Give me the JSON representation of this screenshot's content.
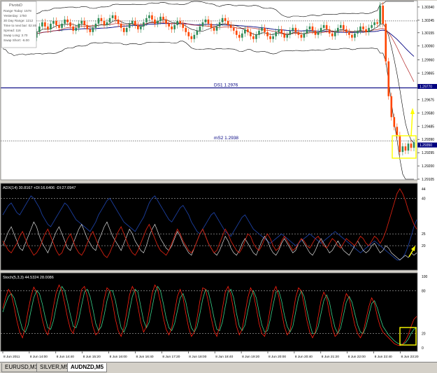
{
  "colors": {
    "main_bg": "#ffffff",
    "indicator_bg": "#000000",
    "bull": "#2e8b57",
    "bear": "#ff4500",
    "band": "#000000",
    "ma_red": "#b22222",
    "ma_navy": "#000080",
    "pivot_line": "#000080",
    "adx_blue": "#1c3f9f",
    "adx_red": "#d02010",
    "adx_white": "#d8d8d8",
    "stoch_red": "#ff2010",
    "stoch_green": "#3ad08a",
    "highlight": "#ffff00"
  },
  "pivot_box": {
    "title": "PivotsD",
    "rows": [
      "Range  Today:   1578",
      "Yesterday:   1750",
      "30 Day Range:   1212",
      "Time to next bar:   02:46",
      "Spread:   116",
      "Swap  Long:   3.70",
      "Swap  Short:   -6.00"
    ]
  },
  "chart_data": [
    {
      "type": "candlestick",
      "name": "AUDNZD,M5",
      "y_axis_labels": [
        "1.30340",
        "1.30245",
        "1.30155",
        "1.30060",
        "1.29960",
        "1.29865",
        "1.29770",
        "1.29675",
        "1.29580",
        "1.29485",
        "1.29390",
        "1.29350",
        "1.29295",
        "1.29200",
        "1.29105"
      ],
      "ylim": [
        1.29105,
        1.3038
      ],
      "levels": [
        {
          "label": "",
          "value": 1.3024,
          "style": "dotted"
        },
        {
          "label": "DS1   1.2976",
          "value": 1.2976,
          "style": "solid"
        },
        {
          "label": "mS2   1.2938",
          "value": 1.2938,
          "style": "dotted"
        }
      ],
      "price_markers": [
        {
          "value": 1.2977,
          "text": "1.29770"
        },
        {
          "value": 1.2935,
          "text": "1.29350"
        }
      ],
      "x_axis_labels": [
        "8 Jun 2011",
        "8 Jun 14:00",
        "8 Jun 14:40",
        "8 Jun 15:20",
        "8 Jun 16:00",
        "8 Jun 16:40",
        "8 Jun 17:20",
        "8 Jun 18:00",
        "8 Jun 18:40",
        "8 Jun 19:20",
        "8 Jun 20:00",
        "8 Jun 20:40",
        "8 Jun 21:20",
        "8 Jun 22:00",
        "8 Jun 22:40",
        "8 Jun 23:20"
      ],
      "series": [
        {
          "name": "price",
          "values": [
            1.3011,
            1.3012,
            1.3009,
            1.3014,
            1.3018,
            1.3016,
            1.3013,
            1.3017,
            1.3021,
            1.3019,
            1.3015,
            1.3012,
            1.3016,
            1.302,
            1.3023,
            1.302,
            1.3018,
            1.3022,
            1.3024,
            1.3021,
            1.3019,
            1.3022,
            1.3025,
            1.3023,
            1.302,
            1.3017,
            1.3019,
            1.3022,
            1.3024,
            1.3021,
            1.3018,
            1.3016,
            1.3019,
            1.3022,
            1.3026,
            1.3024,
            1.3021,
            1.3023,
            1.3026,
            1.3028,
            1.3025,
            1.3022,
            1.3019,
            1.3016,
            1.3019,
            1.3022,
            1.3024,
            1.3021,
            1.3018,
            1.302,
            1.3023,
            1.3026,
            1.3028,
            1.3025,
            1.3022,
            1.3024,
            1.3027,
            1.3025,
            1.3022,
            1.302,
            1.3018,
            1.3021,
            1.3024,
            1.3022,
            1.3019,
            1.3016,
            1.3013,
            1.3011,
            1.3014,
            1.3017,
            1.302,
            1.3023,
            1.3025,
            1.3022,
            1.3019,
            1.3017,
            1.302,
            1.3023,
            1.3026,
            1.3024,
            1.3021,
            1.3019,
            1.3017,
            1.3014,
            1.3012,
            1.3015,
            1.3018,
            1.3016,
            1.3013,
            1.3011,
            1.3014,
            1.3017,
            1.3019,
            1.3016,
            1.3013,
            1.3011,
            1.3013,
            1.3016,
            1.3018,
            1.3015,
            1.3012,
            1.3014,
            1.3017,
            1.3019,
            1.3016,
            1.3014,
            1.3012,
            1.3015,
            1.3018,
            1.302,
            1.3017,
            1.3014,
            1.3016,
            1.3019,
            1.3021,
            1.3018,
            1.3015,
            1.3013,
            1.3016,
            1.3019,
            1.3021,
            1.3018,
            1.3016,
            1.3014,
            1.3012,
            1.3015,
            1.3017,
            1.302,
            1.3018,
            1.3016,
            1.3019,
            1.3021,
            1.3023,
            1.3022,
            1.3035,
            1.3022,
            1.2995,
            1.297,
            1.2955,
            1.2948,
            1.2942,
            1.293,
            1.2934,
            1.2931,
            1.2936,
            1.2933,
            1.2937
          ]
        }
      ]
    },
    {
      "type": "line",
      "name": "ADX(14) 30.8167 +DI:16.6406 -DI:27.0947",
      "y_axis_labels": [
        "44",
        "40",
        "25",
        "20"
      ],
      "ylim": [
        10,
        46
      ],
      "levels": [
        40,
        25,
        20
      ],
      "series": [
        {
          "name": "ADX",
          "values": [
            33,
            35,
            37,
            38,
            36,
            34,
            33,
            35,
            37,
            39,
            41,
            40,
            38,
            36,
            33,
            31,
            29,
            28,
            30,
            32,
            34,
            36,
            38,
            37,
            35,
            33,
            31,
            30,
            29,
            28,
            27,
            26,
            28,
            30,
            33,
            35,
            37,
            39,
            40,
            38,
            36,
            34,
            32,
            30,
            29,
            28,
            27,
            26,
            28,
            30,
            32,
            35,
            38,
            40,
            41,
            39,
            37,
            35,
            33,
            31,
            30,
            32,
            34,
            36,
            37,
            35,
            33,
            30,
            28,
            26,
            25,
            27,
            29,
            31,
            33,
            34,
            32,
            30,
            28,
            26,
            25,
            24,
            26,
            28,
            30,
            32,
            33,
            31,
            29,
            27,
            26,
            25,
            24,
            23,
            22,
            21,
            22,
            23,
            24,
            25,
            24,
            23,
            22,
            21,
            20,
            21,
            22,
            23,
            24,
            25,
            24,
            23,
            22,
            21,
            22,
            23,
            24,
            25,
            26,
            25,
            24,
            23,
            22,
            21,
            20,
            19,
            18,
            17,
            18,
            19,
            20,
            21,
            22,
            21,
            20,
            19,
            18,
            17,
            16,
            15,
            14,
            14,
            15,
            17,
            20,
            24,
            28,
            31
          ]
        },
        {
          "name": "+DI",
          "values": [
            20,
            23,
            26,
            28,
            25,
            22,
            19,
            18,
            21,
            24,
            27,
            30,
            28,
            24,
            21,
            19,
            17,
            20,
            23,
            26,
            28,
            25,
            22,
            19,
            18,
            21,
            24,
            27,
            29,
            26,
            23,
            21,
            19,
            18,
            22,
            25,
            28,
            30,
            27,
            24,
            22,
            20,
            18,
            21,
            24,
            27,
            25,
            22,
            20,
            18,
            17,
            20,
            24,
            27,
            29,
            26,
            23,
            21,
            19,
            18,
            20,
            23,
            26,
            24,
            21,
            19,
            17,
            16,
            19,
            22,
            25,
            27,
            24,
            21,
            19,
            17,
            16,
            18,
            21,
            24,
            22,
            19,
            17,
            16,
            18,
            21,
            23,
            21,
            19,
            17,
            16,
            19,
            22,
            24,
            22,
            19,
            17,
            16,
            18,
            21,
            23,
            21,
            19,
            17,
            18,
            21,
            23,
            21,
            19,
            17,
            16,
            18,
            21,
            23,
            21,
            19,
            17,
            18,
            20,
            22,
            20,
            18,
            17,
            16,
            18,
            20,
            22,
            20,
            18,
            17,
            18,
            20,
            21,
            19,
            17,
            18,
            20,
            19,
            17,
            16,
            15,
            14,
            15,
            16,
            15,
            17,
            16,
            17
          ]
        },
        {
          "name": "-DI",
          "values": [
            22,
            20,
            18,
            17,
            19,
            21,
            24,
            26,
            23,
            20,
            18,
            16,
            17,
            19,
            22,
            25,
            27,
            24,
            21,
            18,
            16,
            17,
            20,
            23,
            25,
            22,
            19,
            17,
            16,
            18,
            21,
            24,
            26,
            23,
            20,
            18,
            16,
            15,
            17,
            20,
            23,
            26,
            28,
            25,
            22,
            19,
            17,
            16,
            18,
            21,
            24,
            27,
            29,
            26,
            23,
            20,
            18,
            17,
            16,
            18,
            21,
            24,
            27,
            25,
            22,
            20,
            18,
            17,
            19,
            22,
            25,
            27,
            24,
            21,
            19,
            17,
            18,
            21,
            24,
            27,
            25,
            22,
            20,
            18,
            17,
            19,
            22,
            25,
            24,
            21,
            19,
            18,
            20,
            23,
            25,
            23,
            20,
            18,
            19,
            22,
            24,
            22,
            20,
            18,
            19,
            21,
            23,
            22,
            20,
            19,
            21,
            23,
            24,
            22,
            20,
            19,
            21,
            23,
            22,
            20,
            19,
            21,
            23,
            22,
            21,
            20,
            22,
            24,
            23,
            21,
            20,
            22,
            24,
            23,
            21,
            23,
            26,
            30,
            34,
            38,
            42,
            44,
            42,
            39,
            35,
            32,
            29,
            27
          ]
        }
      ]
    },
    {
      "type": "line",
      "name": "Stoch(5,3,3) 44.5324 28.0086",
      "y_axis_labels": [
        "100",
        "80",
        "20",
        "0"
      ],
      "ylim": [
        0,
        100
      ],
      "levels": [
        80,
        20
      ],
      "series": [
        {
          "name": "%K",
          "values": [
            55,
            70,
            82,
            75,
            58,
            38,
            22,
            14,
            30,
            52,
            72,
            85,
            78,
            60,
            40,
            25,
            18,
            35,
            58,
            78,
            88,
            80,
            62,
            42,
            26,
            20,
            38,
            62,
            82,
            86,
            72,
            50,
            30,
            18,
            22,
            45,
            68,
            84,
            80,
            62,
            40,
            24,
            16,
            28,
            50,
            74,
            86,
            78,
            58,
            36,
            22,
            30,
            52,
            76,
            88,
            82,
            64,
            42,
            26,
            18,
            28,
            50,
            72,
            82,
            70,
            48,
            28,
            16,
            22,
            42,
            66,
            84,
            82,
            64,
            42,
            24,
            16,
            30,
            55,
            78,
            86,
            74,
            52,
            30,
            18,
            26,
            48,
            70,
            84,
            76,
            56,
            34,
            20,
            16,
            32,
            56,
            78,
            86,
            72,
            50,
            30,
            18,
            24,
            46,
            70,
            84,
            80,
            60,
            38,
            22,
            14,
            22,
            44,
            66,
            78,
            70,
            48,
            28,
            16,
            20,
            40,
            62,
            76,
            70,
            50,
            32,
            20,
            14,
            22,
            40,
            58,
            70,
            62,
            44,
            30,
            22,
            18,
            14,
            10,
            6,
            4,
            3,
            5,
            10,
            18,
            30,
            40,
            44
          ]
        },
        {
          "name": "%D",
          "values": [
            50,
            62,
            72,
            76,
            70,
            56,
            40,
            26,
            22,
            32,
            52,
            70,
            80,
            76,
            62,
            44,
            28,
            26,
            38,
            58,
            76,
            86,
            80,
            64,
            46,
            30,
            28,
            40,
            60,
            78,
            82,
            72,
            54,
            34,
            24,
            30,
            46,
            66,
            80,
            80,
            66,
            46,
            28,
            22,
            32,
            52,
            72,
            82,
            78,
            58,
            38,
            28,
            36,
            56,
            76,
            86,
            80,
            62,
            42,
            28,
            24,
            34,
            52,
            70,
            76,
            64,
            44,
            28,
            22,
            30,
            48,
            68,
            82,
            78,
            62,
            42,
            26,
            24,
            36,
            58,
            78,
            82,
            70,
            48,
            30,
            24,
            32,
            52,
            70,
            80,
            70,
            50,
            32,
            22,
            24,
            40,
            60,
            78,
            80,
            66,
            46,
            30,
            22,
            30,
            50,
            70,
            80,
            72,
            52,
            34,
            20,
            20,
            30,
            48,
            66,
            74,
            64,
            44,
            28,
            20,
            28,
            46,
            64,
            72,
            64,
            48,
            32,
            22,
            20,
            30,
            46,
            62,
            66,
            56,
            42,
            30,
            24,
            18,
            14,
            10,
            7,
            5,
            5,
            7,
            12,
            20,
            26,
            28
          ]
        }
      ]
    }
  ],
  "tabs": [
    "EURUSD,M1",
    "SILVER,M5",
    "AUDNZD,M5"
  ]
}
